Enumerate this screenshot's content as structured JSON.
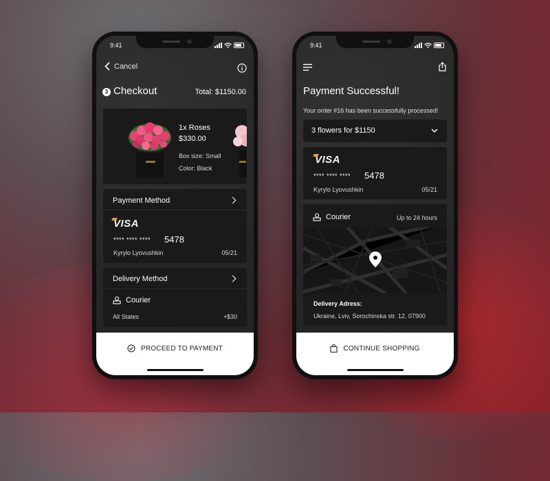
{
  "left": {
    "status_time": "9:41",
    "cancel": "Cancel",
    "step": "3",
    "title": "Checkout",
    "total": "Total: $1150.00",
    "product": {
      "name": "1x Roses",
      "price": "$330.00",
      "box_size": "Box size: Small",
      "color": "Color: Black"
    },
    "payment": {
      "header": "Payment Method",
      "brand": "VISA",
      "masked": "**** **** ****",
      "last4": "5478",
      "holder": "Kyrylo Lyovushkin",
      "expiry": "05/21"
    },
    "delivery": {
      "header": "Delivery Method",
      "method": "Courier",
      "region": "All States",
      "price": "+$30"
    },
    "cta": "PROCEED TO PAYMENT"
  },
  "right": {
    "status_time": "9:41",
    "title": "Payment Successful!",
    "message": "Your order #16 has been successfully processed!",
    "summary": "3 flowers for $1150",
    "payment": {
      "brand": "VISA",
      "masked": "**** **** ****",
      "last4": "5478",
      "holder": "Kyrylo Lyovushkin",
      "expiry": "05/21"
    },
    "delivery": {
      "method": "Courier",
      "eta": "Up to 24 hours",
      "address_label": "Delivery Adress:",
      "address": "Ukraine, Lviv, Sorochinska str. 12, 07900"
    },
    "cta": "CONTINUE SHOPPING"
  },
  "colors": {
    "accent_visa": "#e9a227",
    "card_bg": "#1a1a1a",
    "screen_bg": "#2a2a2a"
  }
}
